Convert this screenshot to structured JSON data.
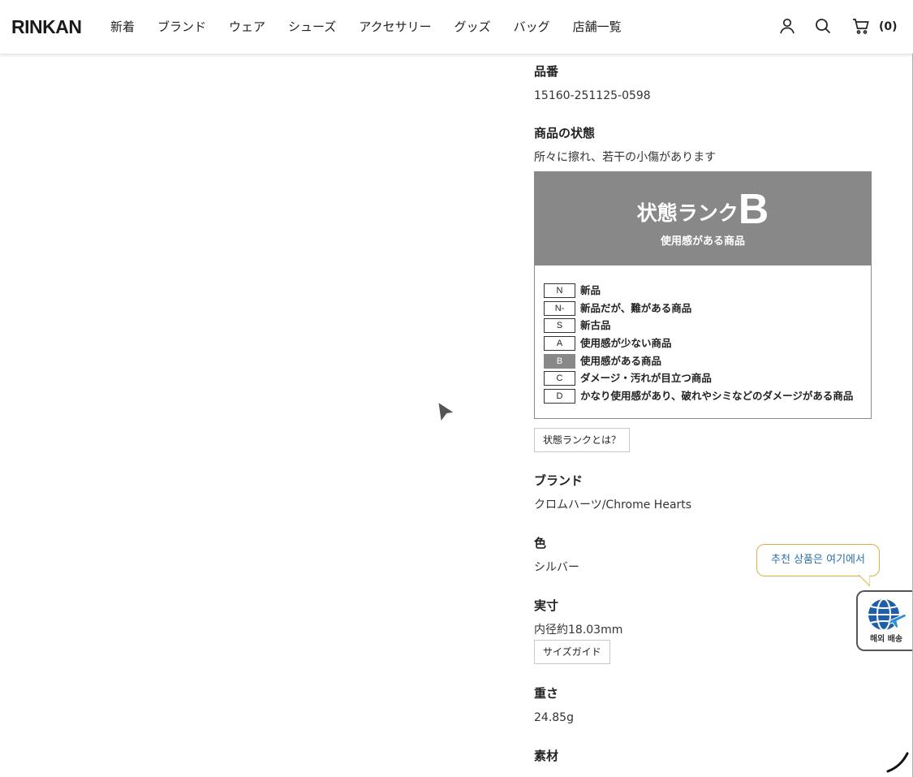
{
  "header": {
    "logo": "RINKAN",
    "nav": [
      "新着",
      "ブランド",
      "ウェア",
      "シューズ",
      "アクセサリー",
      "グッズ",
      "バッグ",
      "店舗一覧"
    ],
    "cart_count": "(0)"
  },
  "details": {
    "item_number_label": "品番",
    "item_number": "15160-251125-0598",
    "condition_label": "商品の状態",
    "condition_text": "所々に擦れ、若干の小傷があります",
    "rank": {
      "title": "状態ランク",
      "letter": "B",
      "subtitle": "使用感がある商品",
      "active_index": 4,
      "levels": [
        {
          "code": "N",
          "desc": "新品"
        },
        {
          "code": "N-",
          "desc": "新品だが、難がある商品"
        },
        {
          "code": "S",
          "desc": "新古品"
        },
        {
          "code": "A",
          "desc": "使用感が少ない商品"
        },
        {
          "code": "B",
          "desc": "使用感がある商品"
        },
        {
          "code": "C",
          "desc": "ダメージ・汚れが目立つ商品"
        },
        {
          "code": "D",
          "desc": "かなり使用感があり、破れやシミなどのダメージがある商品"
        }
      ]
    },
    "rank_help_button": "状態ランクとは？",
    "brand_label": "ブランド",
    "brand": "クロムハーツ/Chrome Hearts",
    "color_label": "色",
    "color": "シルバー",
    "size_label": "実寸",
    "size": "内径約18.03mm",
    "size_guide_button": "サイズガイド",
    "weight_label": "重さ",
    "weight": "24.85g",
    "material_label": "素材"
  },
  "shipping_widget": {
    "tooltip": "추천 상품은 여기에서",
    "label": "해외 배송"
  },
  "colors": {
    "rank_gray": "#888888",
    "tooltip_border": "#d6b44a",
    "tooltip_text": "#2a6fa8",
    "globe_blue": "#1f5fa8"
  },
  "icons": {
    "user": "user-icon",
    "search": "search-icon",
    "cart": "cart-icon",
    "gallery_next": "play-arrow-icon",
    "shipping": "globe-airplane-icon"
  }
}
